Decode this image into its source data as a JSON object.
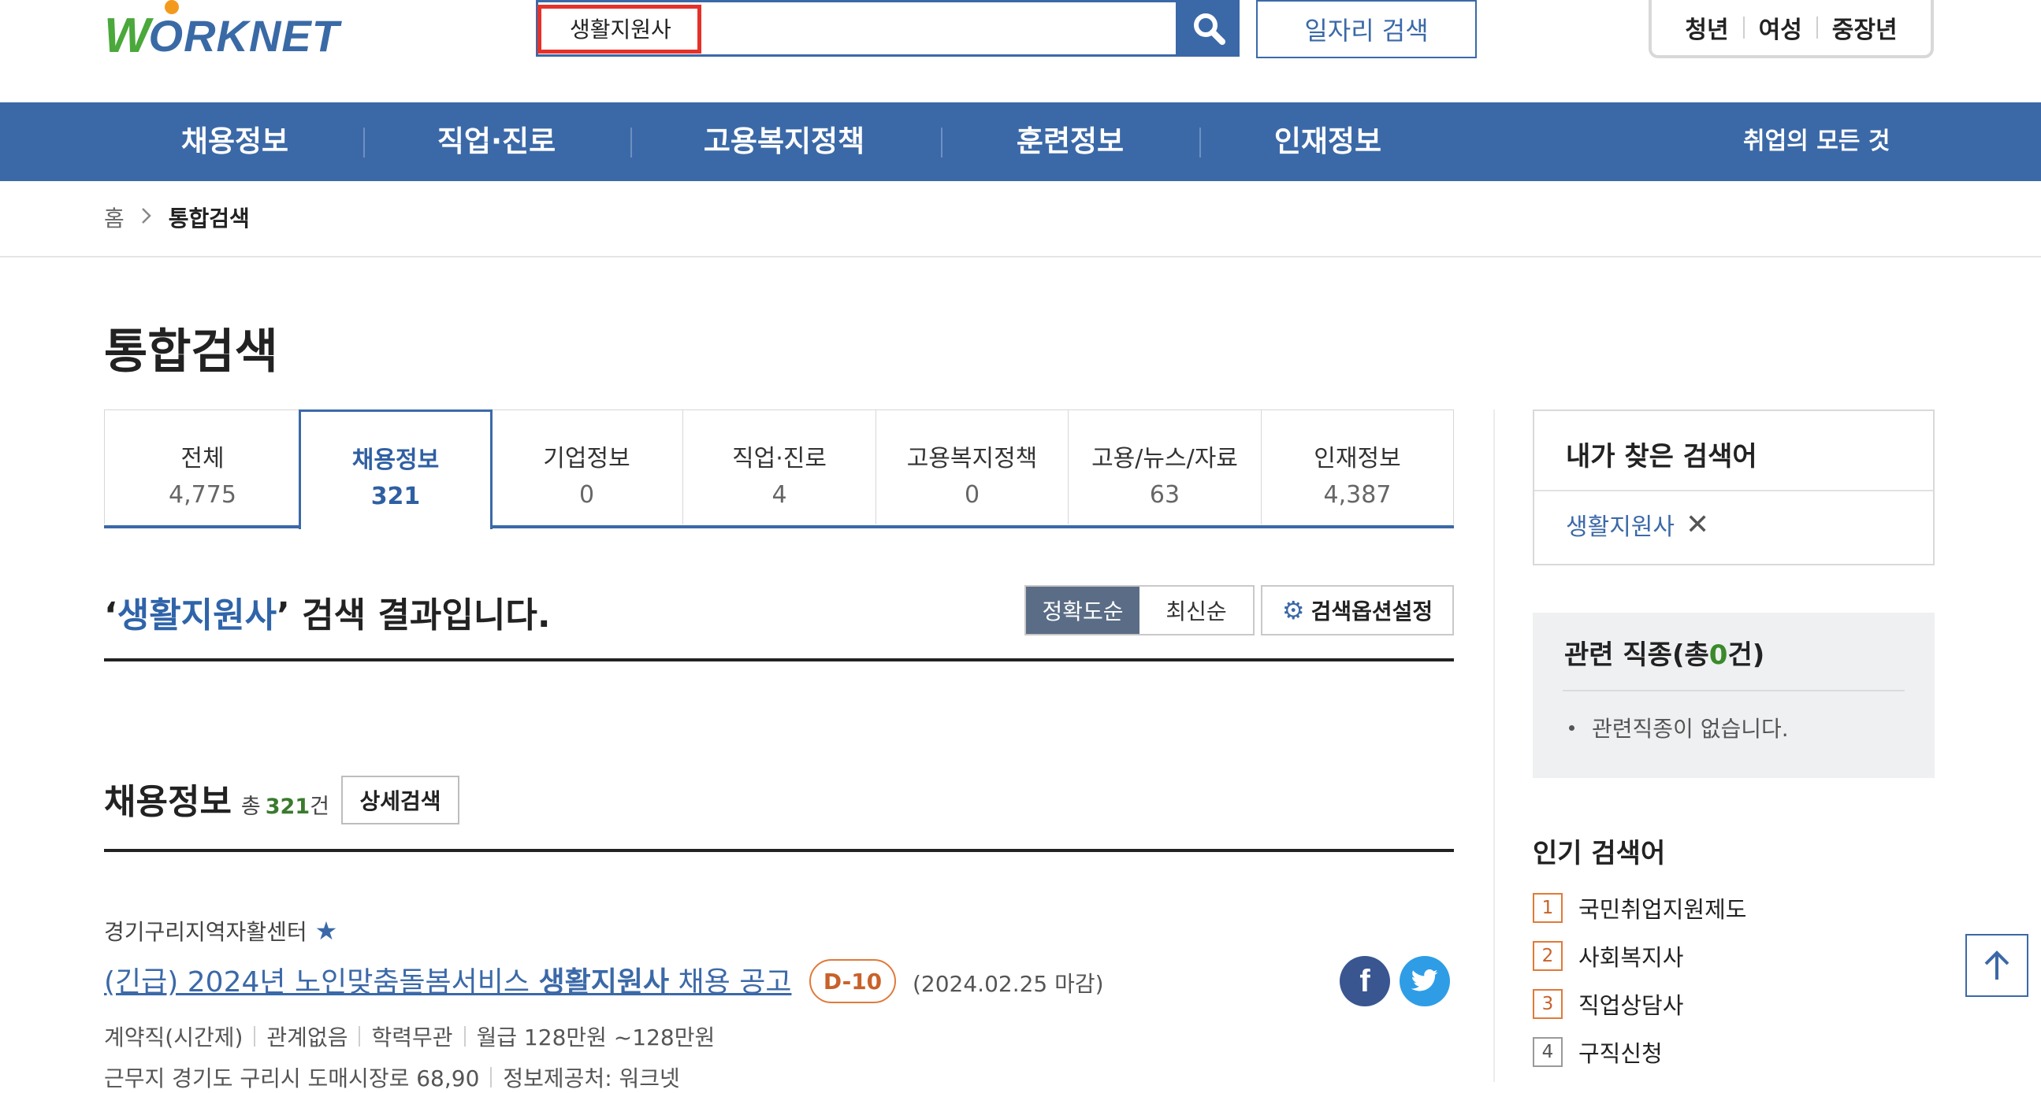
{
  "header": {
    "logo": {
      "w": "W",
      "rest": "ORKNET"
    },
    "search": {
      "value": "생활지원사",
      "placeholder": ""
    },
    "job_search_label": "일자리 검색",
    "segments": [
      "청년",
      "여성",
      "중장년"
    ]
  },
  "nav": {
    "items": [
      "채용정보",
      "직업·진로",
      "고용복지정책",
      "훈련정보",
      "인재정보"
    ],
    "extra": "취업의 모든 것"
  },
  "breadcrumb": {
    "home": "홈",
    "current": "통합검색"
  },
  "page_title": "통합검색",
  "tabs": [
    {
      "label": "전체",
      "count": "4,775"
    },
    {
      "label": "채용정보",
      "count": "321"
    },
    {
      "label": "기업정보",
      "count": "0"
    },
    {
      "label": "직업·진로",
      "count": "4"
    },
    {
      "label": "고용복지정책",
      "count": "0"
    },
    {
      "label": "고용/뉴스/자료",
      "count": "63"
    },
    {
      "label": "인재정보",
      "count": "4,387"
    }
  ],
  "result": {
    "quote_open": "‘",
    "keyword": "생활지원사",
    "quote_close": "’",
    "suffix": " 검색 결과입니다.",
    "sort_options": [
      "정확도순",
      "최신순"
    ],
    "option_label": "검색옵션설정"
  },
  "jobs_section": {
    "title": "채용정보",
    "total_prefix": "총",
    "total_count": "321",
    "total_suffix": "건",
    "detail_search": "상세검색"
  },
  "job": {
    "company": "경기구리지역자활센터",
    "title_pre": "(긴급) 2024년 노인맞춤돌봄서비스 ",
    "title_kw": "생활지원사",
    "title_post": " 채용 공고",
    "dday": "D-10",
    "deadline": "(2024.02.25 마감)",
    "meta": [
      "계약직(시간제)",
      "관계없음",
      "학력무관",
      "월급 128만원 ~128만원"
    ],
    "location": "근무지 경기도 구리시 도매시장로 68,90",
    "provider": "정보제공처: 워크넷"
  },
  "sidebar": {
    "my_search_title": "내가 찾은 검색어",
    "my_search_keyword": "생활지원사",
    "related_title_pre": "관련 직종(총",
    "related_count": "0",
    "related_title_post": "건)",
    "related_empty": "관련직종이 없습니다.",
    "popular_title": "인기 검색어",
    "popular": [
      {
        "rank": "1",
        "term": "국민취업지원제도"
      },
      {
        "rank": "2",
        "term": "사회복지사"
      },
      {
        "rank": "3",
        "term": "직업상담사"
      },
      {
        "rank": "4",
        "term": "구직신청"
      }
    ]
  },
  "colors": {
    "brand_blue": "#3b69a8",
    "logo_green": "#4ba83b",
    "highlight_red": "#e4322b",
    "accent_orange": "#e07a3a"
  },
  "icons": [
    "search-icon",
    "chevron-right-icon",
    "gear-icon",
    "star-icon",
    "close-icon",
    "facebook-icon",
    "twitter-icon",
    "arrow-up-icon"
  ]
}
